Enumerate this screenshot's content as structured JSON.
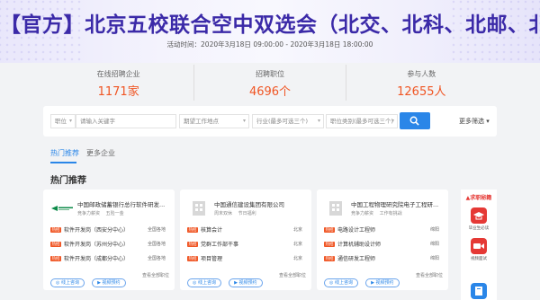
{
  "banner": {
    "title": "【官方】北京五校联合空中双选会（北交、北科、北邮、北林、北化）",
    "time": "活动时间：2020年3月18日 09:00:00 - 2020年3月18日 18:00:00"
  },
  "stats": [
    {
      "label": "在线招聘企业",
      "value": "1171家"
    },
    {
      "label": "招聘职位",
      "value": "4696个"
    },
    {
      "label": "参与人数",
      "value": "12655人"
    }
  ],
  "search": {
    "type_label": "职位",
    "keyword_placeholder": "请输入关键字",
    "location_placeholder": "期望工作地点",
    "industry_placeholder": "行业(最多可选三个)",
    "category_placeholder": "职位类别(最多可选三个)",
    "more_filter": "更多筛选"
  },
  "tabs": [
    "热门推荐",
    "更多企业"
  ],
  "section_title": "热门推荐",
  "cards": [
    {
      "company": "中国邮政储蓄银行总行软件研发...",
      "tags": [
        "竞争力薪资",
        "五险一金"
      ],
      "jobs": [
        {
          "badge": "热招",
          "title": "软件开发岗（西安分中心）",
          "location": "全国各地"
        },
        {
          "badge": "热招",
          "title": "软件开发岗（苏州分中心）",
          "location": "全国各地"
        },
        {
          "badge": "热招",
          "title": "软件开发岗（成都分中心）",
          "location": "全国各地"
        }
      ],
      "btn_consult": "线上咨询",
      "btn_video": "视频预约",
      "view_all": "查看全部职位"
    },
    {
      "company": "中国通信建设集团有限公司",
      "tags": [
        "周末双休",
        "节日福利"
      ],
      "jobs": [
        {
          "badge": "热招",
          "title": "核算会计",
          "location": "北京"
        },
        {
          "badge": "热招",
          "title": "党群工作部干事",
          "location": "北京"
        },
        {
          "badge": "热招",
          "title": "项目管理",
          "location": "北京"
        }
      ],
      "btn_consult": "线上咨询",
      "btn_video": "视频预约",
      "view_all": "查看全部职位"
    },
    {
      "company": "中国工程物理研究院电子工程研...",
      "tags": [
        "竞争力薪资",
        "工作有挑战"
      ],
      "jobs": [
        {
          "badge": "热招",
          "title": "电路设计工程师",
          "location": "绵阳"
        },
        {
          "badge": "热招",
          "title": "计算机辅助设计师",
          "location": "绵阳"
        },
        {
          "badge": "热招",
          "title": "通信研发工程师",
          "location": "绵阳"
        }
      ],
      "btn_consult": "线上咨询",
      "btn_video": "视频预约",
      "view_all": "查看全部职位"
    }
  ],
  "sidebar": {
    "header": "求职秘籍",
    "items": [
      {
        "label": "毕业生必读",
        "icon": "graduation-cap-icon",
        "color": "#e53935"
      },
      {
        "label": "视频面试",
        "icon": "video-camera-icon",
        "color": "#e53935"
      },
      {
        "label": "",
        "icon": "book-icon",
        "color": "#2a86e8"
      }
    ]
  },
  "colors": {
    "accent": "#2a86e8",
    "highlight": "#f05523",
    "title": "#3b2aa8"
  }
}
